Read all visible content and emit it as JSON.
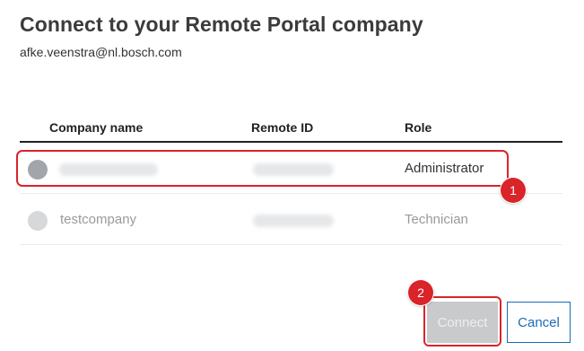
{
  "dialog": {
    "title": "Connect to your Remote Portal company",
    "email": "afke.veenstra@nl.bosch.com"
  },
  "table": {
    "columns": [
      "Company name",
      "Remote ID",
      "Role"
    ],
    "rows": [
      {
        "company_name": "",
        "remote_id": "",
        "role": "Administrator",
        "selected": true,
        "name_redacted": true,
        "id_redacted": true
      },
      {
        "company_name": "testcompany",
        "remote_id": "",
        "role": "Technician",
        "selected": false,
        "name_redacted": false,
        "id_redacted": true
      }
    ]
  },
  "annotations": {
    "step1": "1",
    "step2": "2",
    "color": "#d9242a"
  },
  "buttons": {
    "connect_label": "Connect",
    "connect_enabled": false,
    "cancel_label": "Cancel"
  }
}
